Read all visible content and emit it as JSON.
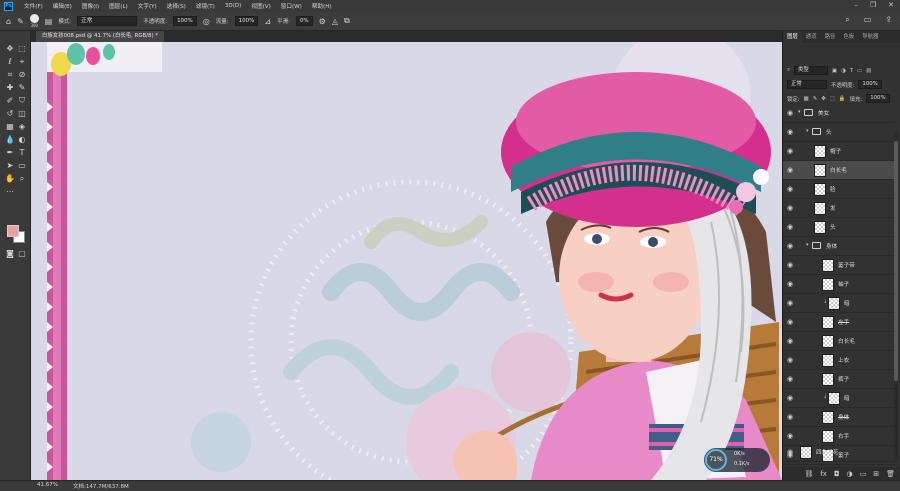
{
  "menu": {
    "logo": "Ps",
    "items": [
      "文件(F)",
      "编辑(E)",
      "图像(I)",
      "图层(L)",
      "文字(Y)",
      "选择(S)",
      "滤镜(T)",
      "3D(D)",
      "视图(V)",
      "窗口(W)",
      "帮助(H)"
    ]
  },
  "options": {
    "brush_size": "300",
    "mode_label": "模式:",
    "mode_value": "正常",
    "opacity_label": "不透明度:",
    "opacity_value": "100%",
    "flow_label": "流量:",
    "flow_value": "100%",
    "smoothing_label": "平滑:",
    "smoothing_value": "0%"
  },
  "document": {
    "tab_title": "白族女孩008.psd @ 41.7% (白长毛, RGB/8) *"
  },
  "status": {
    "zoom": "41.67%",
    "doc_size": "文档:147.7M/637.8M"
  },
  "colors": {
    "foreground": "#e9a19a",
    "background": "#ffffff",
    "canvas_bg": "#d9d8e6",
    "accent_pink": "#e0379a",
    "accent_teal": "#2f7f86"
  },
  "panel": {
    "tabs": [
      "图层",
      "通道",
      "路径",
      "色板",
      "导航器"
    ],
    "filter_value": "类型",
    "blend_mode": "正常",
    "opacity_label": "不透明度:",
    "opacity_value": "100%",
    "lock_label": "锁定:",
    "fill_label": "填充:",
    "fill_value": "100%"
  },
  "layers": [
    {
      "name": "美女",
      "kind": "group",
      "indent": 0,
      "expanded": true
    },
    {
      "name": "头",
      "kind": "group",
      "indent": 1,
      "expanded": true
    },
    {
      "name": "帽子",
      "kind": "layer",
      "indent": 2
    },
    {
      "name": "白长毛",
      "kind": "layer",
      "indent": 2,
      "selected": true
    },
    {
      "name": "脸",
      "kind": "layer",
      "indent": 2
    },
    {
      "name": "发",
      "kind": "layer",
      "indent": 2
    },
    {
      "name": "头",
      "kind": "layer",
      "indent": 2
    },
    {
      "name": "身体",
      "kind": "group",
      "indent": 1,
      "expanded": true
    },
    {
      "name": "篓子带",
      "kind": "layer",
      "indent": 2
    },
    {
      "name": "袖子",
      "kind": "layer",
      "indent": 2
    },
    {
      "name": "暗",
      "kind": "layer",
      "indent": 2,
      "clipped": true
    },
    {
      "name": "左手",
      "kind": "layer",
      "indent": 2,
      "strike": true
    },
    {
      "name": "白长毛",
      "kind": "layer",
      "indent": 2
    },
    {
      "name": "上衣",
      "kind": "layer",
      "indent": 2
    },
    {
      "name": "裤子",
      "kind": "layer",
      "indent": 2
    },
    {
      "name": "暗",
      "kind": "layer",
      "indent": 2,
      "clipped": true
    },
    {
      "name": "身体",
      "kind": "layer",
      "indent": 2,
      "strike": true
    },
    {
      "name": "右手",
      "kind": "layer",
      "indent": 2
    },
    {
      "name": "篓子",
      "kind": "layer",
      "indent": 2
    },
    {
      "name": "四角绣花",
      "kind": "layer",
      "indent": 0
    }
  ],
  "perf": {
    "value": "71",
    "unit": "%",
    "line1": "0K/s",
    "line2": "0.1K/s"
  }
}
